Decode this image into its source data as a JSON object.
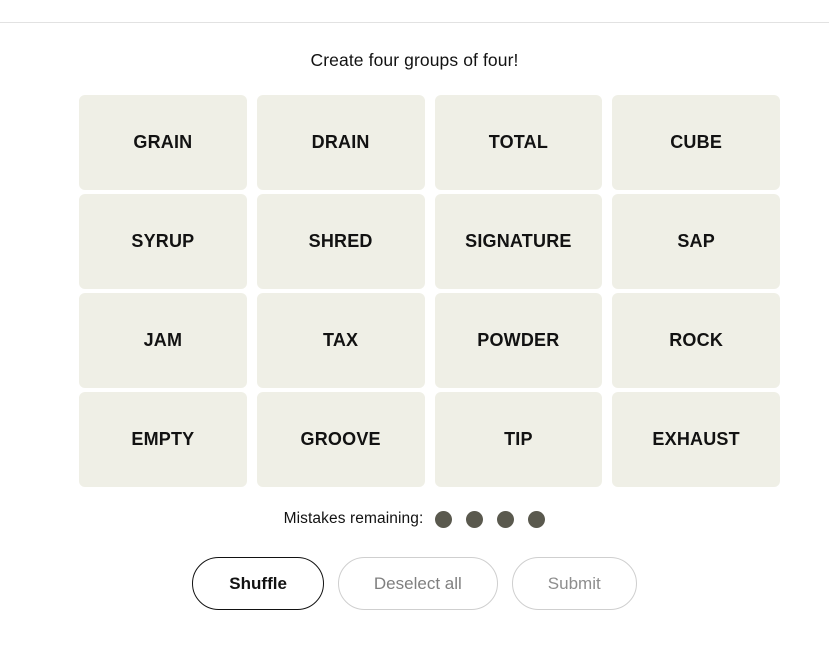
{
  "header": {
    "instruction": "Create four groups of four!"
  },
  "board": {
    "rows": [
      [
        "GRAIN",
        "DRAIN",
        "TOTAL",
        "CUBE"
      ],
      [
        "SYRUP",
        "SHRED",
        "SIGNATURE",
        "SAP"
      ],
      [
        "JAM",
        "TAX",
        "POWDER",
        "ROCK"
      ],
      [
        "EMPTY",
        "GROOVE",
        "TIP",
        "EXHAUST"
      ]
    ],
    "tiles": [
      "GRAIN",
      "DRAIN",
      "TOTAL",
      "CUBE",
      "SYRUP",
      "SHRED",
      "SIGNATURE",
      "SAP",
      "JAM",
      "TAX",
      "POWDER",
      "ROCK",
      "EMPTY",
      "GROOVE",
      "TIP",
      "EXHAUST"
    ],
    "tile_background": "#EFEFE6",
    "tile_text_color": "#121212"
  },
  "mistakes": {
    "label": "Mistakes remaining:",
    "remaining": 4,
    "dot_color": "#5A594E"
  },
  "actions": {
    "shuffle_label": "Shuffle",
    "deselect_label": "Deselect all",
    "submit_label": "Submit"
  },
  "colors": {
    "page_background": "#FFFFFF",
    "divider": "#E2E2E2",
    "primary_border": "#121212",
    "muted_border": "#CFCFCF",
    "muted_text": "#8D8D8D"
  }
}
